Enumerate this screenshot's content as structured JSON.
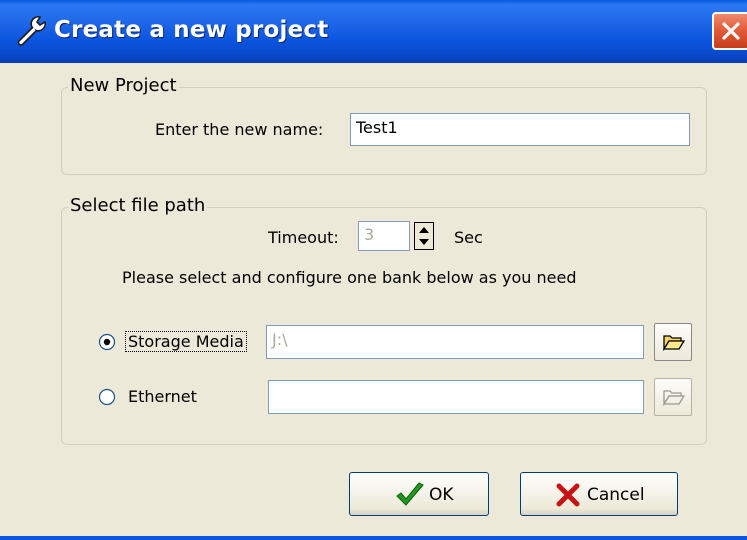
{
  "window": {
    "title": "Create a new project",
    "title_icon": "wrench-icon",
    "close_icon": "close-icon"
  },
  "new_project": {
    "group_title": "New Project",
    "name_label": "Enter the new name:",
    "name_value": "Test1"
  },
  "file_path": {
    "group_title": "Select file path",
    "timeout_label": "Timeout:",
    "timeout_value": "3",
    "timeout_unit": "Sec",
    "instruction": "Please select and configure one bank below as you need",
    "options": [
      {
        "label": "Storage Media",
        "selected": true,
        "path": "J:\\",
        "browse_icon": "folder-open-icon",
        "browse_enabled": true
      },
      {
        "label": "Ethernet",
        "selected": false,
        "path": "",
        "browse_icon": "folder-open-icon",
        "browse_enabled": false
      }
    ]
  },
  "buttons": {
    "ok_label": "OK",
    "ok_icon": "checkmark-icon",
    "cancel_label": "Cancel",
    "cancel_icon": "x-icon"
  },
  "colors": {
    "titlebar": "#0b54df",
    "dialog_bg": "#ece9d8",
    "close_button": "#e35d3b",
    "ok_check": "#1e9a1e",
    "cancel_x": "#c81414"
  }
}
